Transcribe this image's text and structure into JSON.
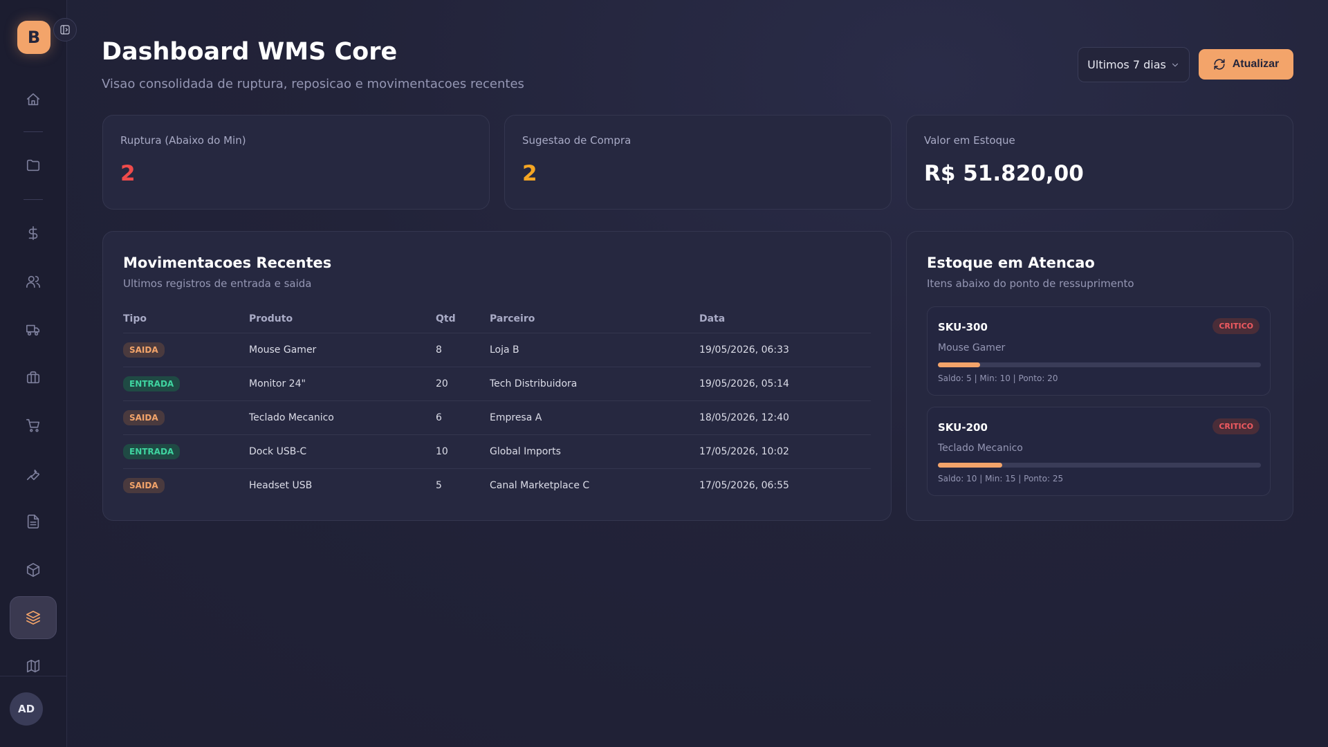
{
  "sidebar": {
    "logo_letter": "B",
    "avatar_initials": "AD",
    "items": [
      {
        "icon": "home-icon"
      },
      {
        "icon": "folder-icon"
      },
      {
        "icon": "dollar-icon"
      },
      {
        "icon": "users-icon"
      },
      {
        "icon": "truck-icon"
      },
      {
        "icon": "briefcase-icon"
      },
      {
        "icon": "cart-icon"
      },
      {
        "icon": "wrench-icon"
      },
      {
        "icon": "document-icon"
      },
      {
        "icon": "package-icon"
      },
      {
        "icon": "layers-icon",
        "active": true
      },
      {
        "icon": "map-icon"
      }
    ]
  },
  "header": {
    "title": "Dashboard WMS Core",
    "subtitle": "Visao consolidada de ruptura, reposicao e movimentacoes recentes",
    "range_label": "Ultimos 7 dias",
    "refresh_label": "Atualizar"
  },
  "kpis": [
    {
      "label": "Ruptura (Abaixo do Min)",
      "value": "2",
      "color": "#ef4b4b"
    },
    {
      "label": "Sugestao de Compra",
      "value": "2",
      "color": "#f5a623"
    },
    {
      "label": "Valor em Estoque",
      "value": "R$ 51.820,00",
      "color": "#ffffff"
    }
  ],
  "movements": {
    "title": "Movimentacoes Recentes",
    "subtitle": "Ultimos registros de entrada e saida",
    "columns": [
      "Tipo",
      "Produto",
      "Qtd",
      "Parceiro",
      "Data"
    ],
    "rows": [
      {
        "type": "SAIDA",
        "product": "Mouse Gamer",
        "qty": "8",
        "partner": "Loja B",
        "date": "19/05/2026, 06:33"
      },
      {
        "type": "ENTRADA",
        "product": "Monitor 24\"",
        "qty": "20",
        "partner": "Tech Distribuidora",
        "date": "19/05/2026, 05:14"
      },
      {
        "type": "SAIDA",
        "product": "Teclado Mecanico",
        "qty": "6",
        "partner": "Empresa A",
        "date": "18/05/2026, 12:40"
      },
      {
        "type": "ENTRADA",
        "product": "Dock USB-C",
        "qty": "10",
        "partner": "Global Imports",
        "date": "17/05/2026, 10:02"
      },
      {
        "type": "SAIDA",
        "product": "Headset USB",
        "qty": "5",
        "partner": "Canal Marketplace C",
        "date": "17/05/2026, 06:55"
      }
    ]
  },
  "attention": {
    "title": "Estoque em Atencao",
    "subtitle": "Itens abaixo do ponto de ressuprimento",
    "items": [
      {
        "sku": "SKU-300",
        "name": "Mouse Gamer",
        "badge": "CRITICO",
        "meta": "Saldo: 5 | Min: 10 | Ponto: 20",
        "level": 0.13
      },
      {
        "sku": "SKU-200",
        "name": "Teclado Mecanico",
        "badge": "CRITICO",
        "meta": "Saldo: 10 | Min: 15 | Ponto: 25",
        "level": 0.2
      }
    ]
  }
}
